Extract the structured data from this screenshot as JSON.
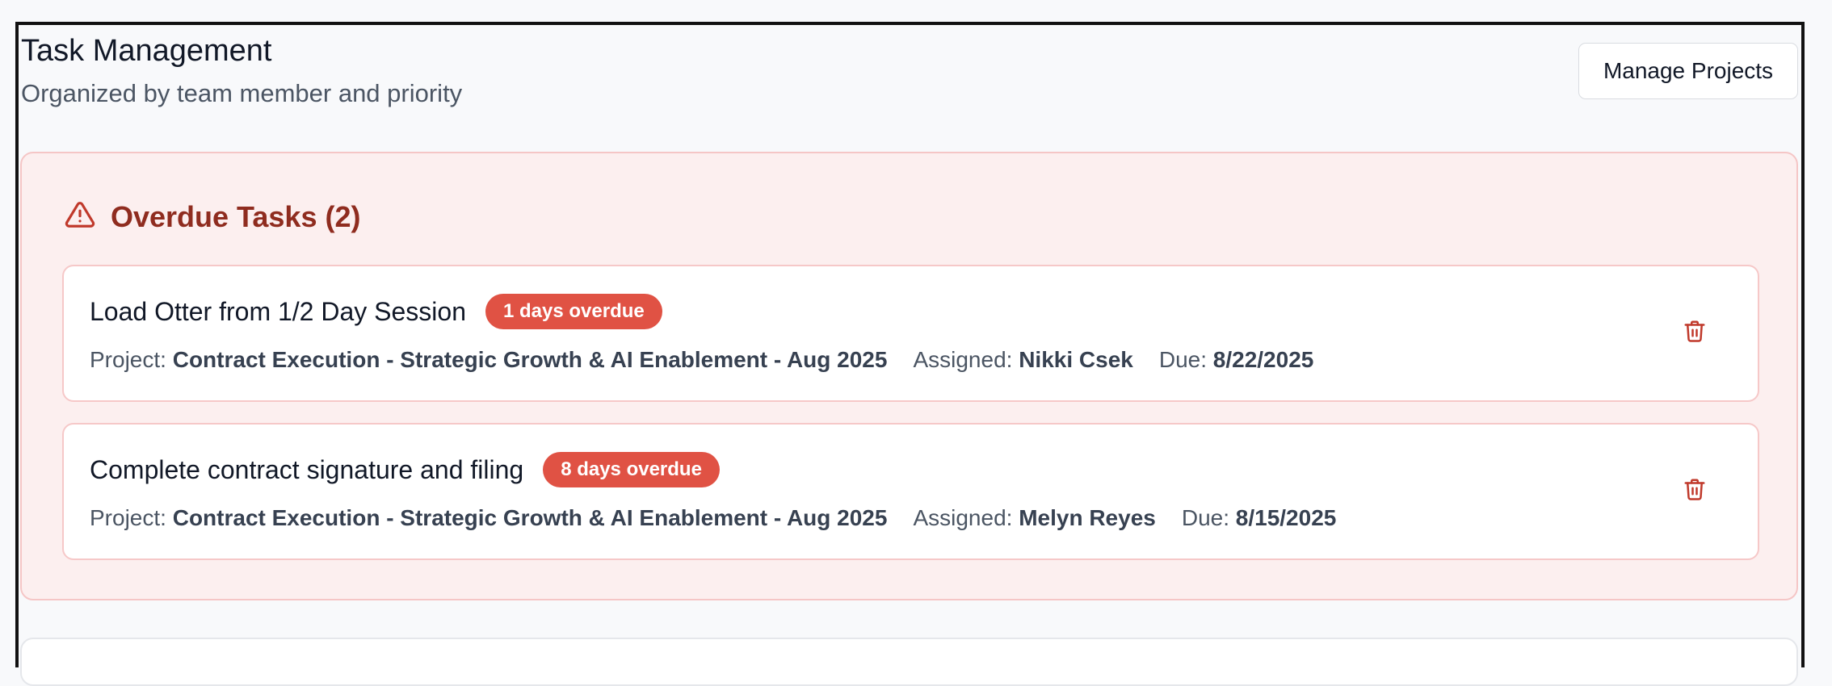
{
  "header": {
    "title": "Task Management",
    "subtitle": "Organized by team member and priority",
    "manage_projects_label": "Manage Projects"
  },
  "overdue": {
    "title": "Overdue Tasks (2)",
    "icon": "warning-triangle-icon",
    "accent_color": "#8f2c1f",
    "badge_color": "#e05244",
    "tasks": [
      {
        "title": "Load Otter from 1/2 Day Session",
        "badge": "1 days overdue",
        "project_label": "Project:",
        "project": "Contract Execution - Strategic Growth & AI Enablement - Aug 2025",
        "assigned_label": "Assigned:",
        "assigned": "Nikki Csek",
        "due_label": "Due:",
        "due": "8/22/2025"
      },
      {
        "title": "Complete contract signature and filing",
        "badge": "8 days overdue",
        "project_label": "Project:",
        "project": "Contract Execution - Strategic Growth & AI Enablement - Aug 2025",
        "assigned_label": "Assigned:",
        "assigned": "Melyn Reyes",
        "due_label": "Due:",
        "due": "8/15/2025"
      }
    ]
  }
}
